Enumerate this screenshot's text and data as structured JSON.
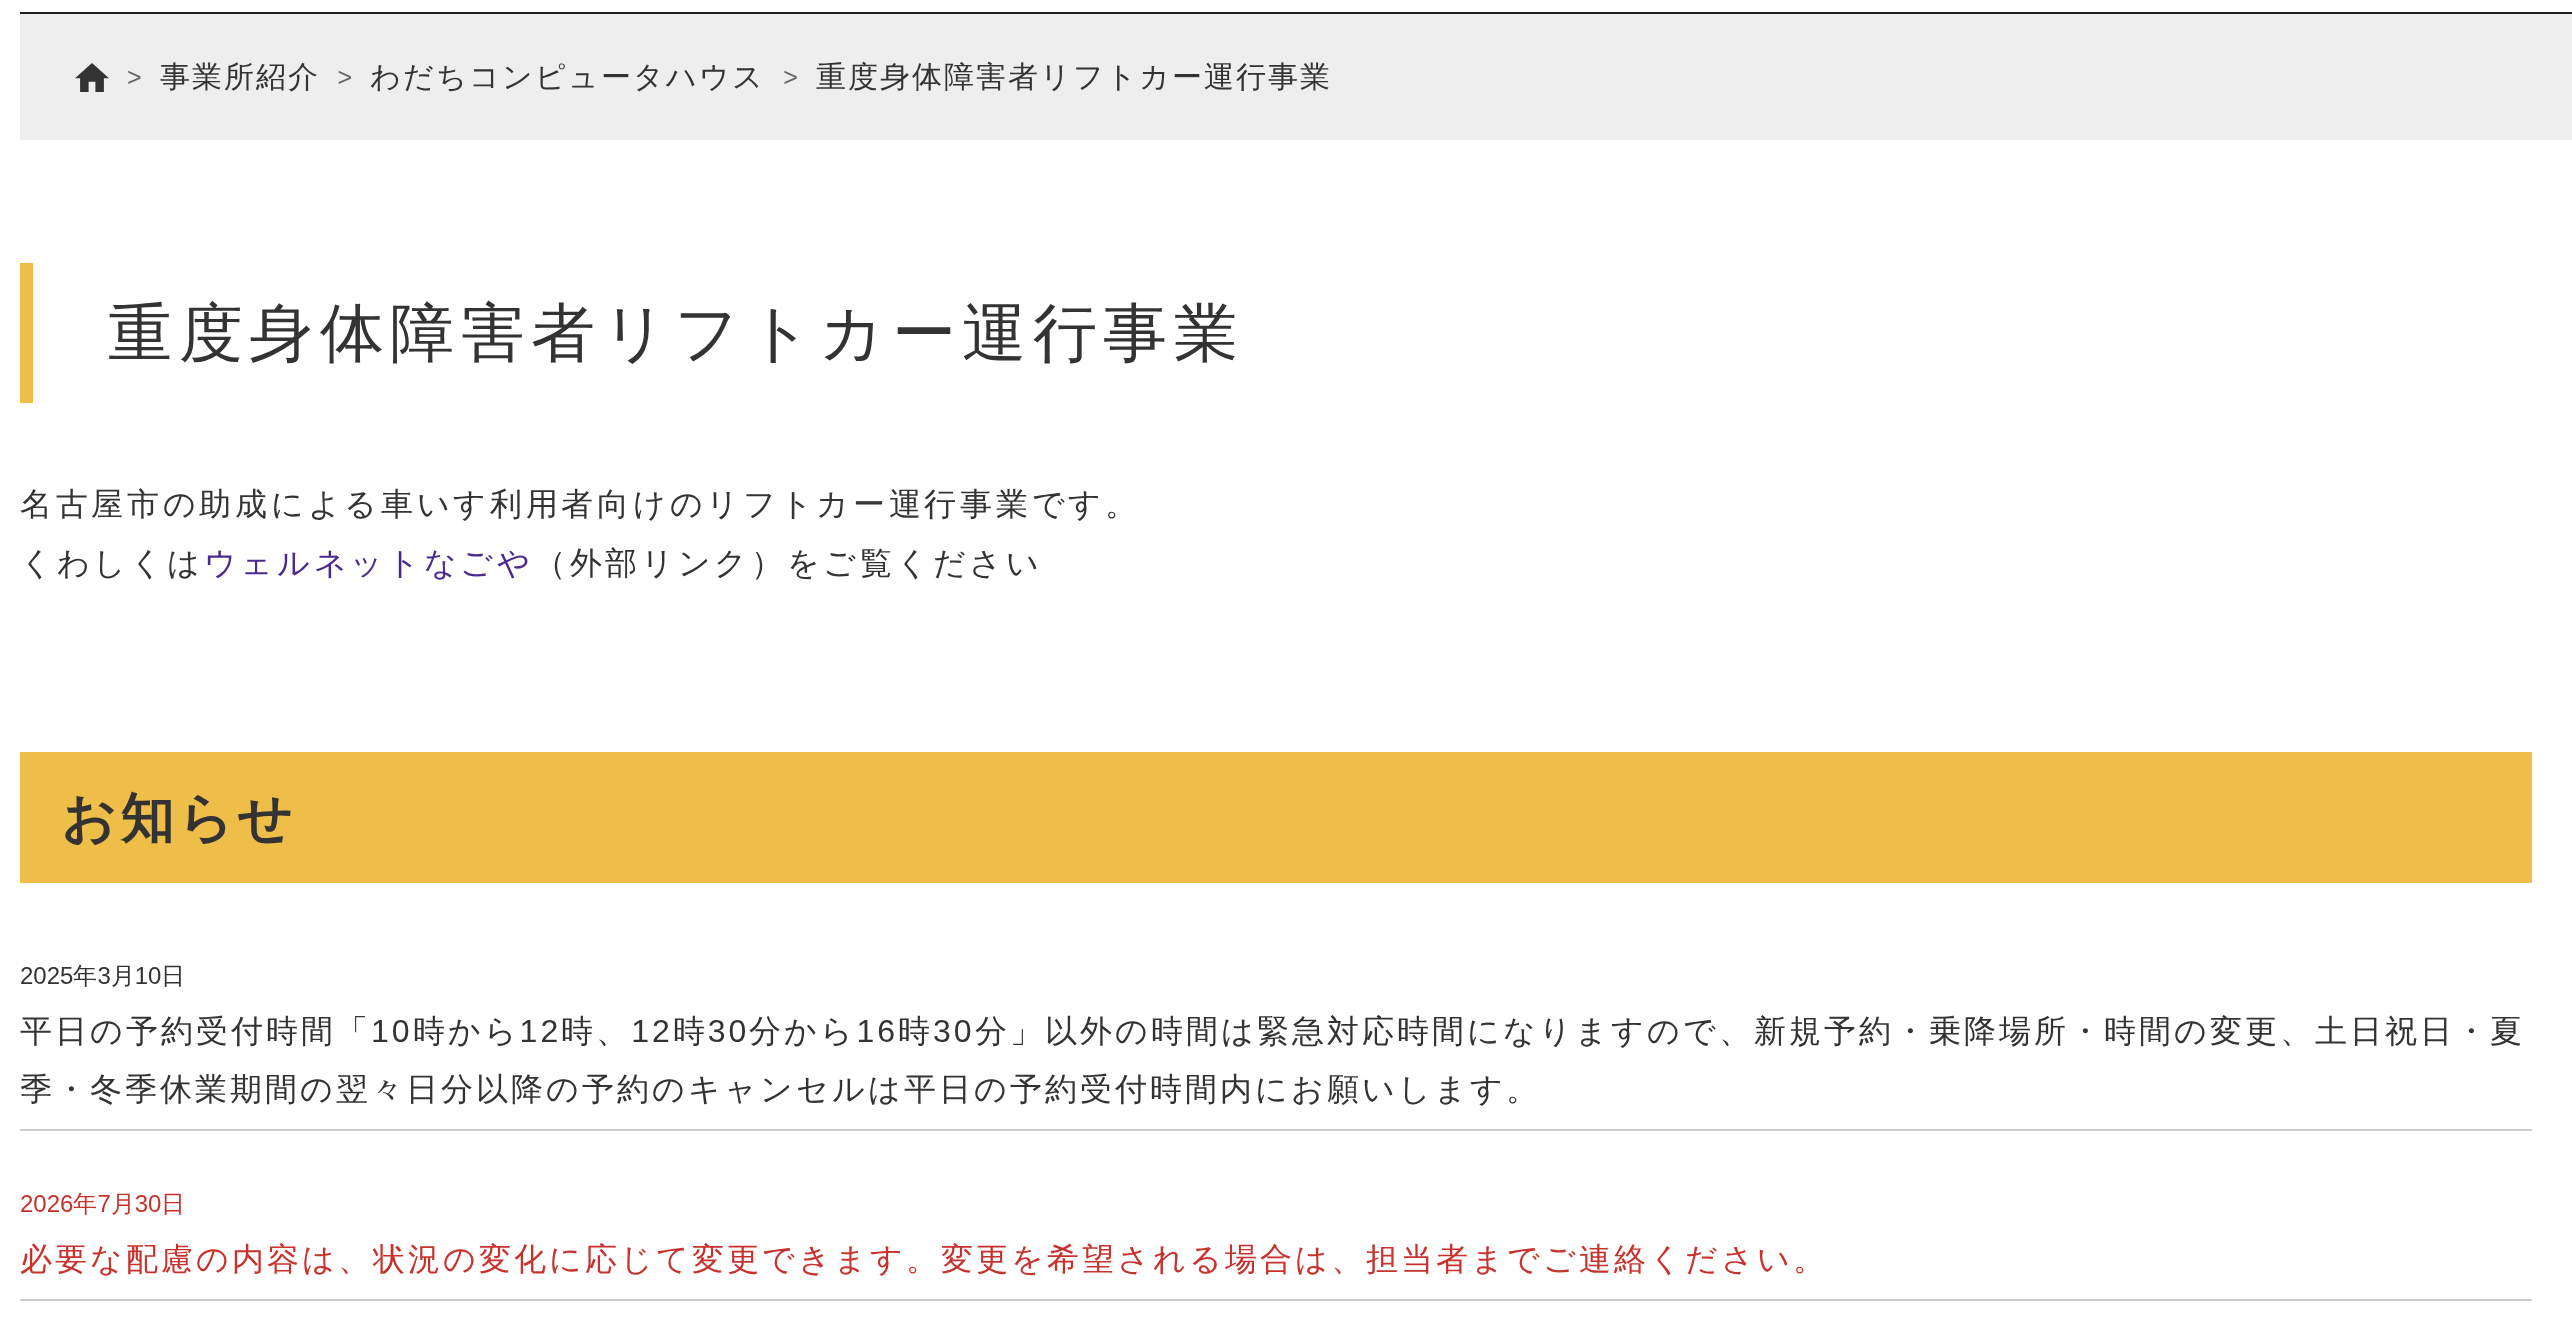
{
  "breadcrumb": {
    "items": [
      {
        "kind": "home"
      },
      {
        "kind": "page",
        "separator": ">",
        "label": "事業所紹介"
      },
      {
        "kind": "page",
        "separator": ">",
        "label": "わだちコンピュータハウス"
      },
      {
        "kind": "page",
        "separator": ">",
        "label": "重度身体障害者リフトカー運行事業"
      }
    ]
  },
  "page_title": "重度身体障害者リフトカー運行事業",
  "intro": {
    "lines": [
      {
        "text": "名古屋市の助成による車いす利用者向けのリフトカー運行事業です。"
      },
      {
        "text": "くわしくは",
        "link": "ウェルネットなごや",
        "after": "（外部リンク）をご覧ください"
      }
    ]
  },
  "notices": {
    "heading": "お知らせ",
    "items": [
      {
        "date": "2025年3月10日",
        "text": "平日の予約受付時間「10時から12時、12時30分から16時30分」以外の時間は緊急対応時間になりますので、新規予約・乗降場所・時間の変更、土日祝日・夏季・冬季休業期間の翌々日分以降の予約のキャンセルは平日の予約受付時間内にお願いします。",
        "color": "#333333"
      },
      {
        "date": "2026年7月30日",
        "text": "必要な配慮の内容は、状況の変化に応じて変更できます。変更を希望される場合は、担当者までご連絡ください。",
        "color": "#c8322d"
      }
    ]
  }
}
